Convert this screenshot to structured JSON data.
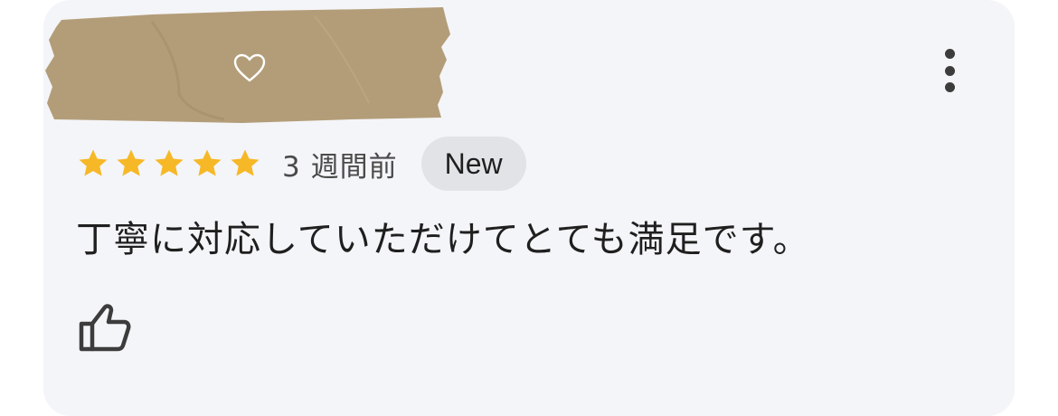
{
  "review": {
    "rating": 5,
    "time_ago": "3 週間前",
    "badge": "New",
    "text": "丁寧に対応していただけてとても満足です。"
  },
  "icons": {
    "redaction_heart": "heart-outline-icon",
    "more": "more-vertical-icon",
    "star": "star-icon",
    "like": "thumbs-up-icon"
  },
  "colors": {
    "card_background": "#f4f5f8",
    "star": "#f6b827",
    "badge_background": "#e1e3e6",
    "tape": "#b39d79"
  }
}
